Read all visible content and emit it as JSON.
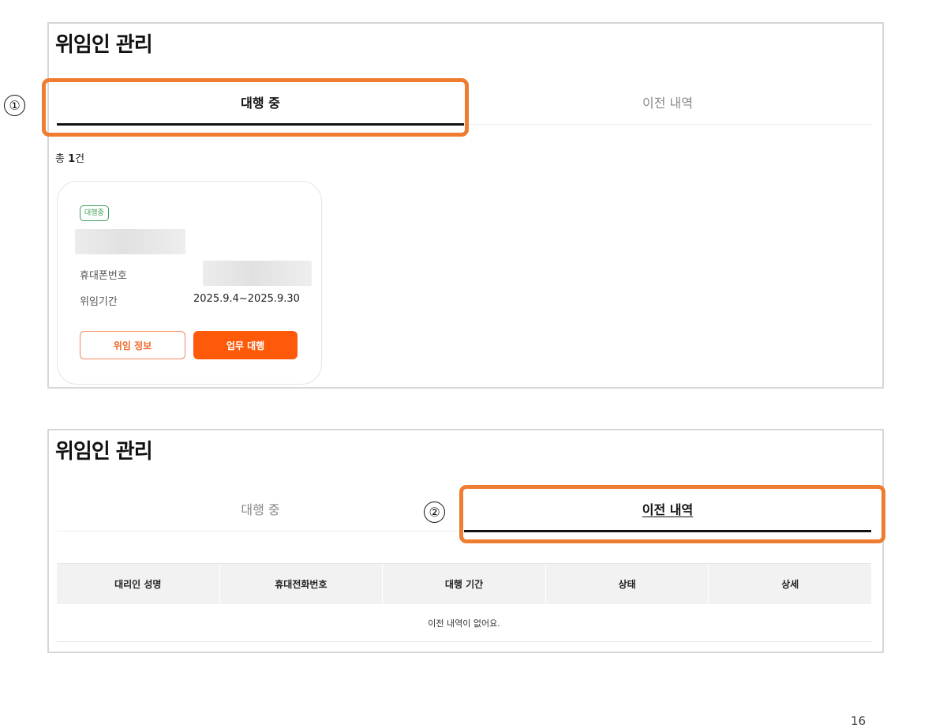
{
  "screen1": {
    "title": "위임인 관리",
    "tabs": [
      {
        "label": "대행 중",
        "active": true
      },
      {
        "label": "이전 내역",
        "active": false
      }
    ],
    "count_prefix": "총 ",
    "count_value": "1",
    "count_suffix": "건",
    "card": {
      "badge": "대행중",
      "phone_label": "휴대폰번호",
      "period_label": "위임기간",
      "period_value": "2025.9.4~2025.9.30",
      "button_info": "위임 정보",
      "button_act": "업무 대행"
    }
  },
  "screen2": {
    "title": "위임인 관리",
    "tabs": [
      {
        "label": "대행 중",
        "active": false
      },
      {
        "label": "이전 내역",
        "active": true
      }
    ],
    "table": {
      "columns": [
        "대리인 성명",
        "휴대전화번호",
        "대행 기간",
        "상태",
        "상세"
      ],
      "empty_message": "이전 내역이 없어요."
    }
  },
  "annotations": {
    "marker1": "①",
    "marker2": "②",
    "color": "#ee7d31"
  },
  "page_number": "16",
  "colors": {
    "accent": "#ff5a0a",
    "badge_green": "#3f9e5a"
  }
}
